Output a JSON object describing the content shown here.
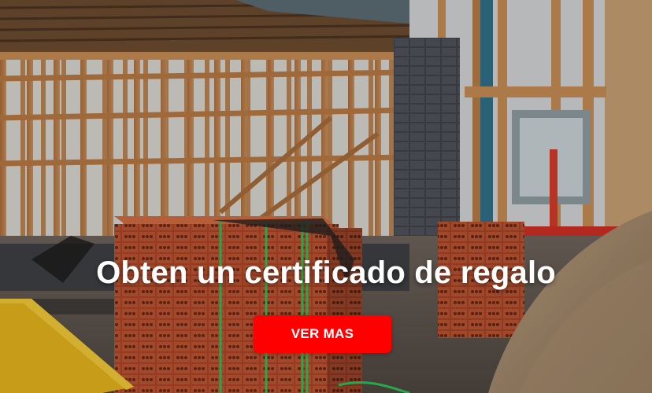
{
  "banner": {
    "headline": "Obten un certificado de regalo",
    "button_label": "VER MAS",
    "background_description_icon": "construction-site-photo"
  },
  "colors": {
    "button_background": "#ff0000",
    "text": "#ffffff"
  }
}
